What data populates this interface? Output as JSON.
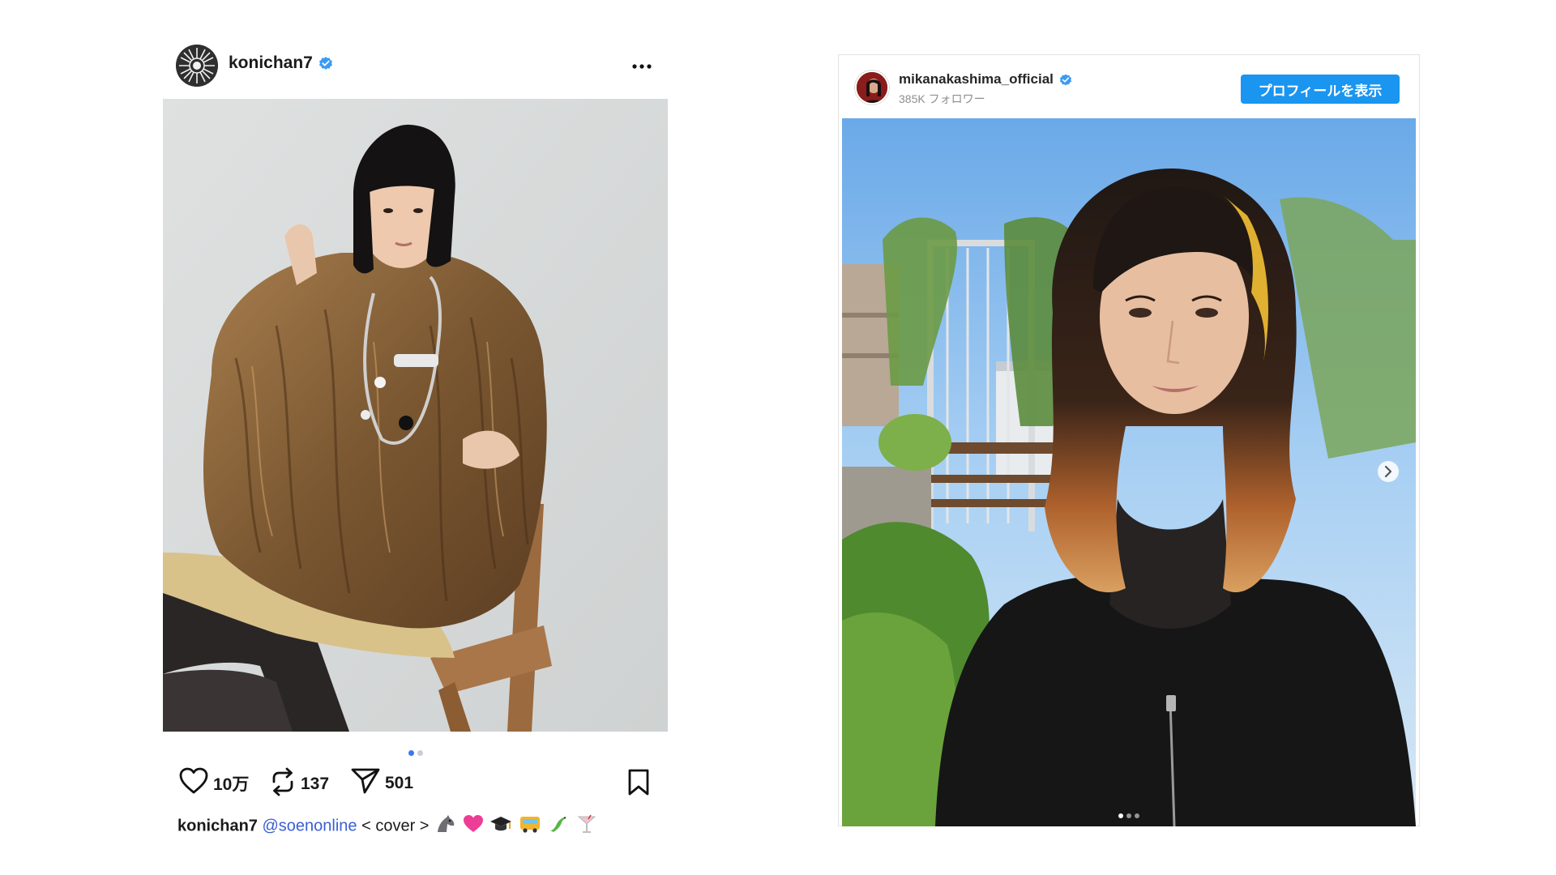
{
  "left_post": {
    "username": "konichan7",
    "likes": "10万",
    "reposts": "137",
    "shares": "501",
    "carousel": {
      "count": 2,
      "active": 1
    },
    "caption": {
      "username": "konichan7",
      "mention": "@soenonline",
      "text": "< cover >",
      "emojis": [
        "horse",
        "pink-heart",
        "graduation-cap",
        "bus",
        "lizard",
        "cocktail"
      ]
    },
    "icons": [
      "heart-icon",
      "repost-icon",
      "send-icon",
      "bookmark-icon",
      "more-icon",
      "verified-icon"
    ]
  },
  "right_post": {
    "username": "mikanakashima_official",
    "followers": "385K フォロワー",
    "profile_button": "プロフィールを表示",
    "carousel": {
      "count": 3,
      "active": 1
    },
    "accent_color": "#1a95f0"
  }
}
